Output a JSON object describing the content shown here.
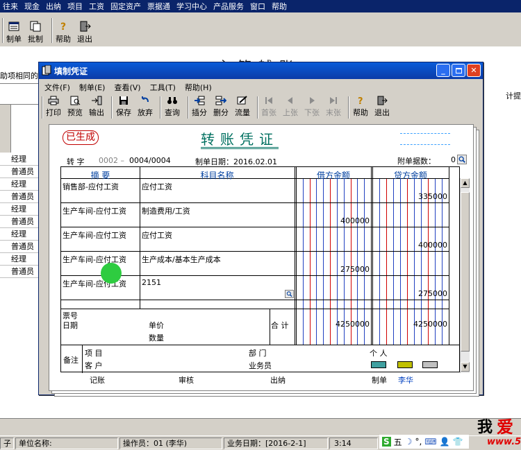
{
  "main_menu": [
    "往来",
    "现金",
    "出纳",
    "项目",
    "工资",
    "固定资产",
    "票据通",
    "学习中心",
    "产品服务",
    "窗口",
    "帮助"
  ],
  "main_toolbar": [
    {
      "label": "制单",
      "icon": "voucher-icon"
    },
    {
      "label": "批制",
      "icon": "batch-icon"
    },
    {
      "label": "帮助",
      "icon": "help-icon"
    },
    {
      "label": "退出",
      "icon": "exit-icon"
    }
  ],
  "background": {
    "title": "主管辅账",
    "left_label": "助项相同的",
    "right_label": "计提",
    "rows": [
      "经理",
      "普通员",
      "经理",
      "普通员",
      "经理",
      "普通员",
      "经理",
      "普通员",
      "经理",
      "普通员"
    ]
  },
  "status_bar": {
    "unit_prefix": "子",
    "unit_label": "单位名称:",
    "operator": "操作员：01 (李华)",
    "business_date": "业务日期：[2016-2-1]",
    "time": "3:14"
  },
  "ime": [
    "S",
    "五",
    "☽",
    "°,",
    "⌨",
    "👤",
    "👕"
  ],
  "watermark": {
    "text1": "我",
    "text2": "爱",
    "text3": "www.5"
  },
  "dialog": {
    "title": "填制凭证",
    "menu": [
      "文件(F)",
      "制单(E)",
      "查看(V)",
      "工具(T)",
      "帮助(H)"
    ],
    "toolbar": [
      {
        "label": "打印",
        "icon": "printer-icon",
        "enabled": true
      },
      {
        "label": "预览",
        "icon": "preview-icon",
        "enabled": true
      },
      {
        "label": "输出",
        "icon": "export-icon",
        "enabled": true
      },
      {
        "label": "保存",
        "icon": "save-icon",
        "enabled": true
      },
      {
        "label": "放弃",
        "icon": "undo-icon",
        "enabled": true
      },
      {
        "label": "查询",
        "icon": "binoculars-icon",
        "enabled": true
      },
      {
        "label": "插分",
        "icon": "insert-row-icon",
        "enabled": true
      },
      {
        "label": "删分",
        "icon": "delete-row-icon",
        "enabled": true
      },
      {
        "label": "流量",
        "icon": "cashflow-icon",
        "enabled": true
      },
      {
        "label": "首张",
        "icon": "first-icon",
        "enabled": false
      },
      {
        "label": "上张",
        "icon": "prev-icon",
        "enabled": false
      },
      {
        "label": "下张",
        "icon": "next-icon",
        "enabled": false
      },
      {
        "label": "末张",
        "icon": "last-icon",
        "enabled": false
      },
      {
        "label": "帮助",
        "icon": "help-icon",
        "enabled": true
      },
      {
        "label": "退出",
        "icon": "exit-icon",
        "enabled": true
      }
    ],
    "voucher": {
      "stamp": "已生成",
      "title": "转账凭证",
      "type": "转 字",
      "num_prefix": "0002 –",
      "num": "0004/0004",
      "date": "制单日期：2016.02.01",
      "attachments_label": "附单据数：",
      "attachments": "0",
      "headers": {
        "summary": "摘 要",
        "account": "科目名称",
        "debit": "借方金额",
        "credit": "贷方金额"
      },
      "rows": [
        {
          "summary": "销售部-应付工资",
          "account": "应付工资",
          "debit": "",
          "credit": "335000"
        },
        {
          "summary": "生产车间-应付工资",
          "account": "制造费用/工资",
          "debit": "400000",
          "credit": ""
        },
        {
          "summary": "生产车间-应付工资",
          "account": "应付工资",
          "debit": "",
          "credit": "400000"
        },
        {
          "summary": "生产车间-应付工资",
          "account": "生产成本/基本生产成本",
          "debit": "275000",
          "credit": ""
        },
        {
          "summary": "生产车间-应付工资",
          "account": "2151",
          "debit": "",
          "credit": "275000"
        }
      ],
      "bill_no": "票号",
      "date_label": "日期",
      "unit_price": "单价",
      "quantity": "数量",
      "total_label": "合 计",
      "total_debit": "4250000",
      "total_credit": "4250000",
      "remark": "备注",
      "project": "项    目",
      "customer": "客    户",
      "dept": "部    门",
      "salesman": "业务员",
      "person": "个    人",
      "sign_bookkeep": "记账",
      "sign_audit": "审核",
      "sign_cashier": "出纳",
      "sign_maker": "制单",
      "maker_name": "李华"
    }
  },
  "colors": {
    "titlebar": "#0b3ca8",
    "voucher_title": "#007060",
    "stamp": "#c00000",
    "header_text": "#0040a0"
  }
}
